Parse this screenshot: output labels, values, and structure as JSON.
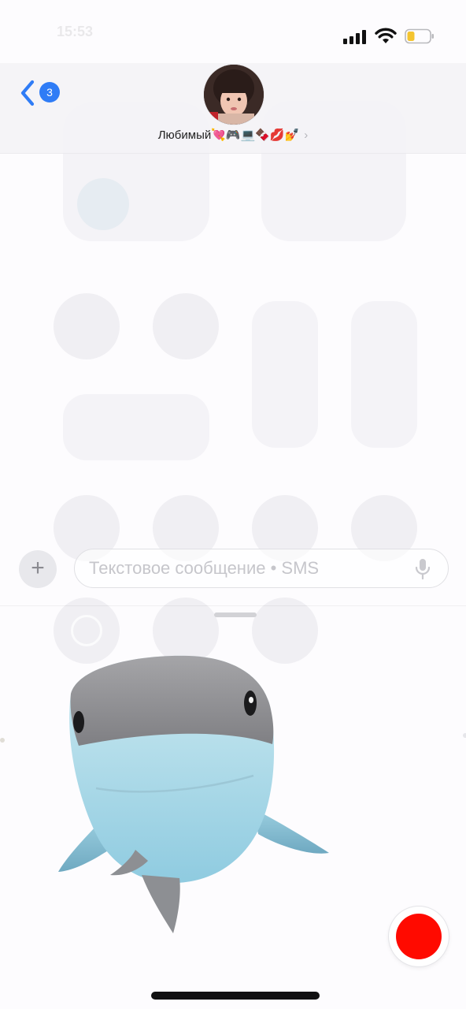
{
  "status_bar": {
    "time": "15:53",
    "battery_color": "#f4c430"
  },
  "header": {
    "back_badge_count": "3",
    "contact_name": "Любимый💘🎮💻🍫💋💅",
    "name_chevron": "›"
  },
  "compose": {
    "plus_label": "+",
    "input_placeholder": "Текстовое сообщение • SMS",
    "input_value": ""
  },
  "memoji": {
    "character": "shark"
  },
  "colors": {
    "accent": "#2f7cf6",
    "record": "#ff0a00",
    "shark_top": "#8f8f92",
    "shark_belly": "#a9dbe8"
  },
  "icons": {
    "back": "chevron-left-icon",
    "signal": "cellular-signal-icon",
    "wifi": "wifi-icon",
    "battery": "battery-icon",
    "mic": "microphone-icon",
    "plus": "plus-icon"
  }
}
